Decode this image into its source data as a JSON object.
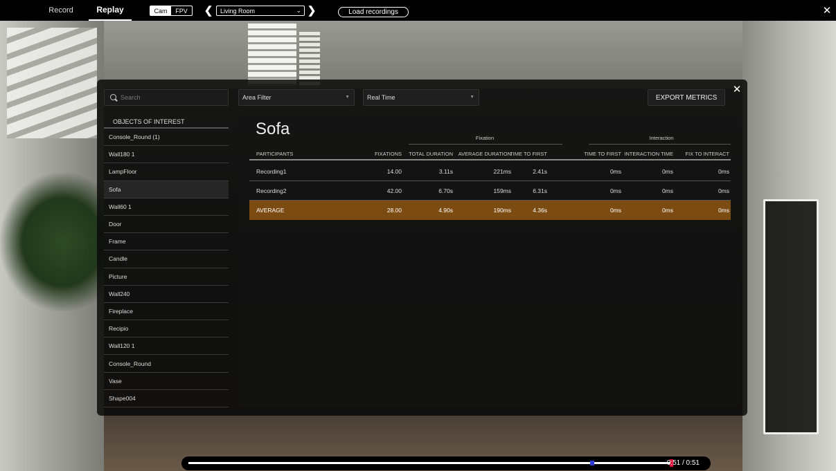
{
  "topbar": {
    "tabs": [
      "Record",
      "Replay"
    ],
    "active_tab": "Replay",
    "view_options": [
      "Cam",
      "FPV"
    ],
    "active_view": "Cam",
    "room": "Living Room",
    "load_label": "Load recordings"
  },
  "panel": {
    "search_placeholder": "Search",
    "area_filter": "Area Filter",
    "time_mode": "Real Time",
    "export_label": "EXPORT METRICS",
    "objects_header": "OBJECTS OF INTEREST",
    "selected_object": "Sofa",
    "objects": [
      "Console_Round (1)",
      "Wall180 1",
      "LampFloor",
      "Sofa",
      "Wall60 1",
      "Door",
      "Frame",
      "Candle",
      "Picture",
      "Wall240",
      "Fireplace",
      "Recipio",
      "Wall120 1",
      "Console_Round",
      "Vase",
      "Shape004"
    ],
    "groups": {
      "fixation": "Fixation",
      "interaction": "Interaction"
    },
    "columns": {
      "participants": "PARTICIPANTS",
      "fixations": "FIXATIONS",
      "total_duration": "TOTAL DURATION",
      "average_duration": "AVERAGE DURATION",
      "time_to_first": "TIME TO FIRST",
      "int_time_to_first": "TIME TO FIRST",
      "interaction_time": "INTERACTION TIME",
      "fix_to_interact": "FIX TO INTERACT"
    },
    "rows": [
      {
        "name": "Recording1",
        "fixations": "14.00",
        "total": "3.11s",
        "average": "221ms",
        "ttf": "2.41s",
        "ittf": "0ms",
        "itime": "0ms",
        "fti": "0ms"
      },
      {
        "name": "Recording2",
        "fixations": "42.00",
        "total": "6.70s",
        "average": "159ms",
        "ttf": "6.31s",
        "ittf": "0ms",
        "itime": "0ms",
        "fti": "0ms"
      },
      {
        "name": "AVERAGE",
        "fixations": "28.00",
        "total": "4.90s",
        "average": "190ms",
        "ttf": "4.36s",
        "ittf": "0ms",
        "itime": "0ms",
        "fti": "0ms"
      }
    ]
  },
  "timeline": {
    "time_readout": "0:51 / 0:51",
    "progress": 1.0,
    "marker_fraction": 0.836
  },
  "colors": {
    "highlight_row": "#7c4b12",
    "marker": "#2f3bd6",
    "playhead": "#e0123a"
  }
}
